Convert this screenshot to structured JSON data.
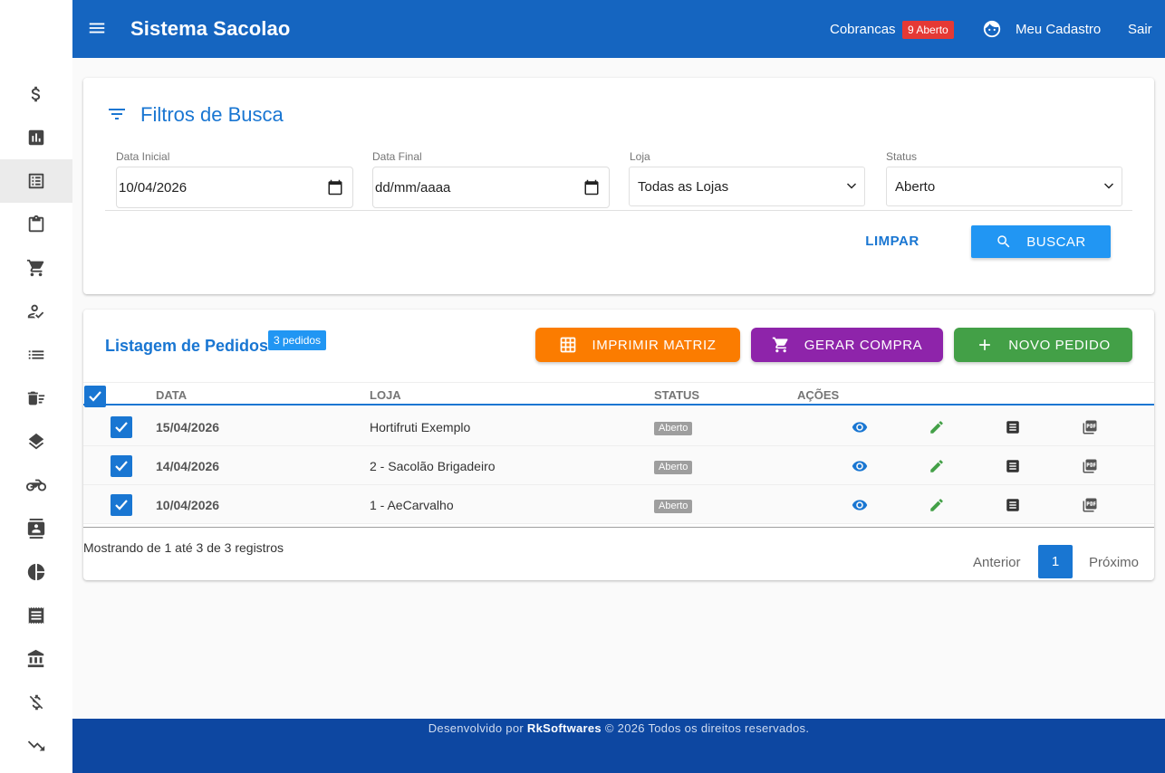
{
  "header": {
    "title": "Sistema Sacolao",
    "cobrancas_label": "Cobrancas",
    "cobrancas_badge": "9 Aberto",
    "cadastro_label": "Meu Cadastro",
    "sair_label": "Sair"
  },
  "sidebar": {
    "items": [
      {
        "icon": "dollar-icon"
      },
      {
        "icon": "bar-chart-icon"
      },
      {
        "icon": "list-alt-icon",
        "active": true
      },
      {
        "icon": "clipboard-icon"
      },
      {
        "icon": "cart-icon"
      },
      {
        "icon": "person-check-icon"
      },
      {
        "icon": "list-icon"
      },
      {
        "icon": "delete-sweep-icon"
      },
      {
        "icon": "layers-icon"
      },
      {
        "icon": "motorcycle-icon"
      },
      {
        "icon": "contact-icon"
      },
      {
        "icon": "pie-chart-icon"
      },
      {
        "icon": "receipt-icon"
      },
      {
        "icon": "bank-icon"
      },
      {
        "icon": "money-off-icon"
      },
      {
        "icon": "trending-down-icon"
      }
    ]
  },
  "filters": {
    "title": "Filtros de Busca",
    "data_inicial": {
      "label": "Data Inicial",
      "value": "10/04/2026"
    },
    "data_final": {
      "label": "Data Final",
      "value": "dd/mm/aaaa"
    },
    "loja": {
      "label": "Loja",
      "value": "Todas as Lojas"
    },
    "status": {
      "label": "Status",
      "value": "Aberto"
    },
    "limpar_label": "LIMPAR",
    "buscar_label": "BUSCAR"
  },
  "listing": {
    "title": "Listagem de Pedidos",
    "count_badge": "3 pedidos",
    "imprimir_label": "IMPRIMIR MATRIZ",
    "gerar_label": "GERAR COMPRA",
    "novo_label": "NOVO PEDIDO",
    "columns": [
      "DATA",
      "LOJA",
      "STATUS",
      "AÇÕES"
    ],
    "rows": [
      {
        "data": "15/04/2026",
        "loja": "Hortifruti Exemplo",
        "status": "Aberto"
      },
      {
        "data": "14/04/2026",
        "loja": "2 - Sacolão Brigadeiro",
        "status": "Aberto"
      },
      {
        "data": "10/04/2026",
        "loja": "1 - AeCarvalho",
        "status": "Aberto"
      }
    ],
    "showing_text": "Mostrando de 1 até 3 de 3 registros",
    "pagination": {
      "prev": "Anterior",
      "current": "1",
      "next": "Próximo"
    }
  },
  "footer": {
    "prefix": "Desenvolvido por",
    "company": "RkSoftwares",
    "suffix": "© 2026 Todos os direitos reservados."
  }
}
